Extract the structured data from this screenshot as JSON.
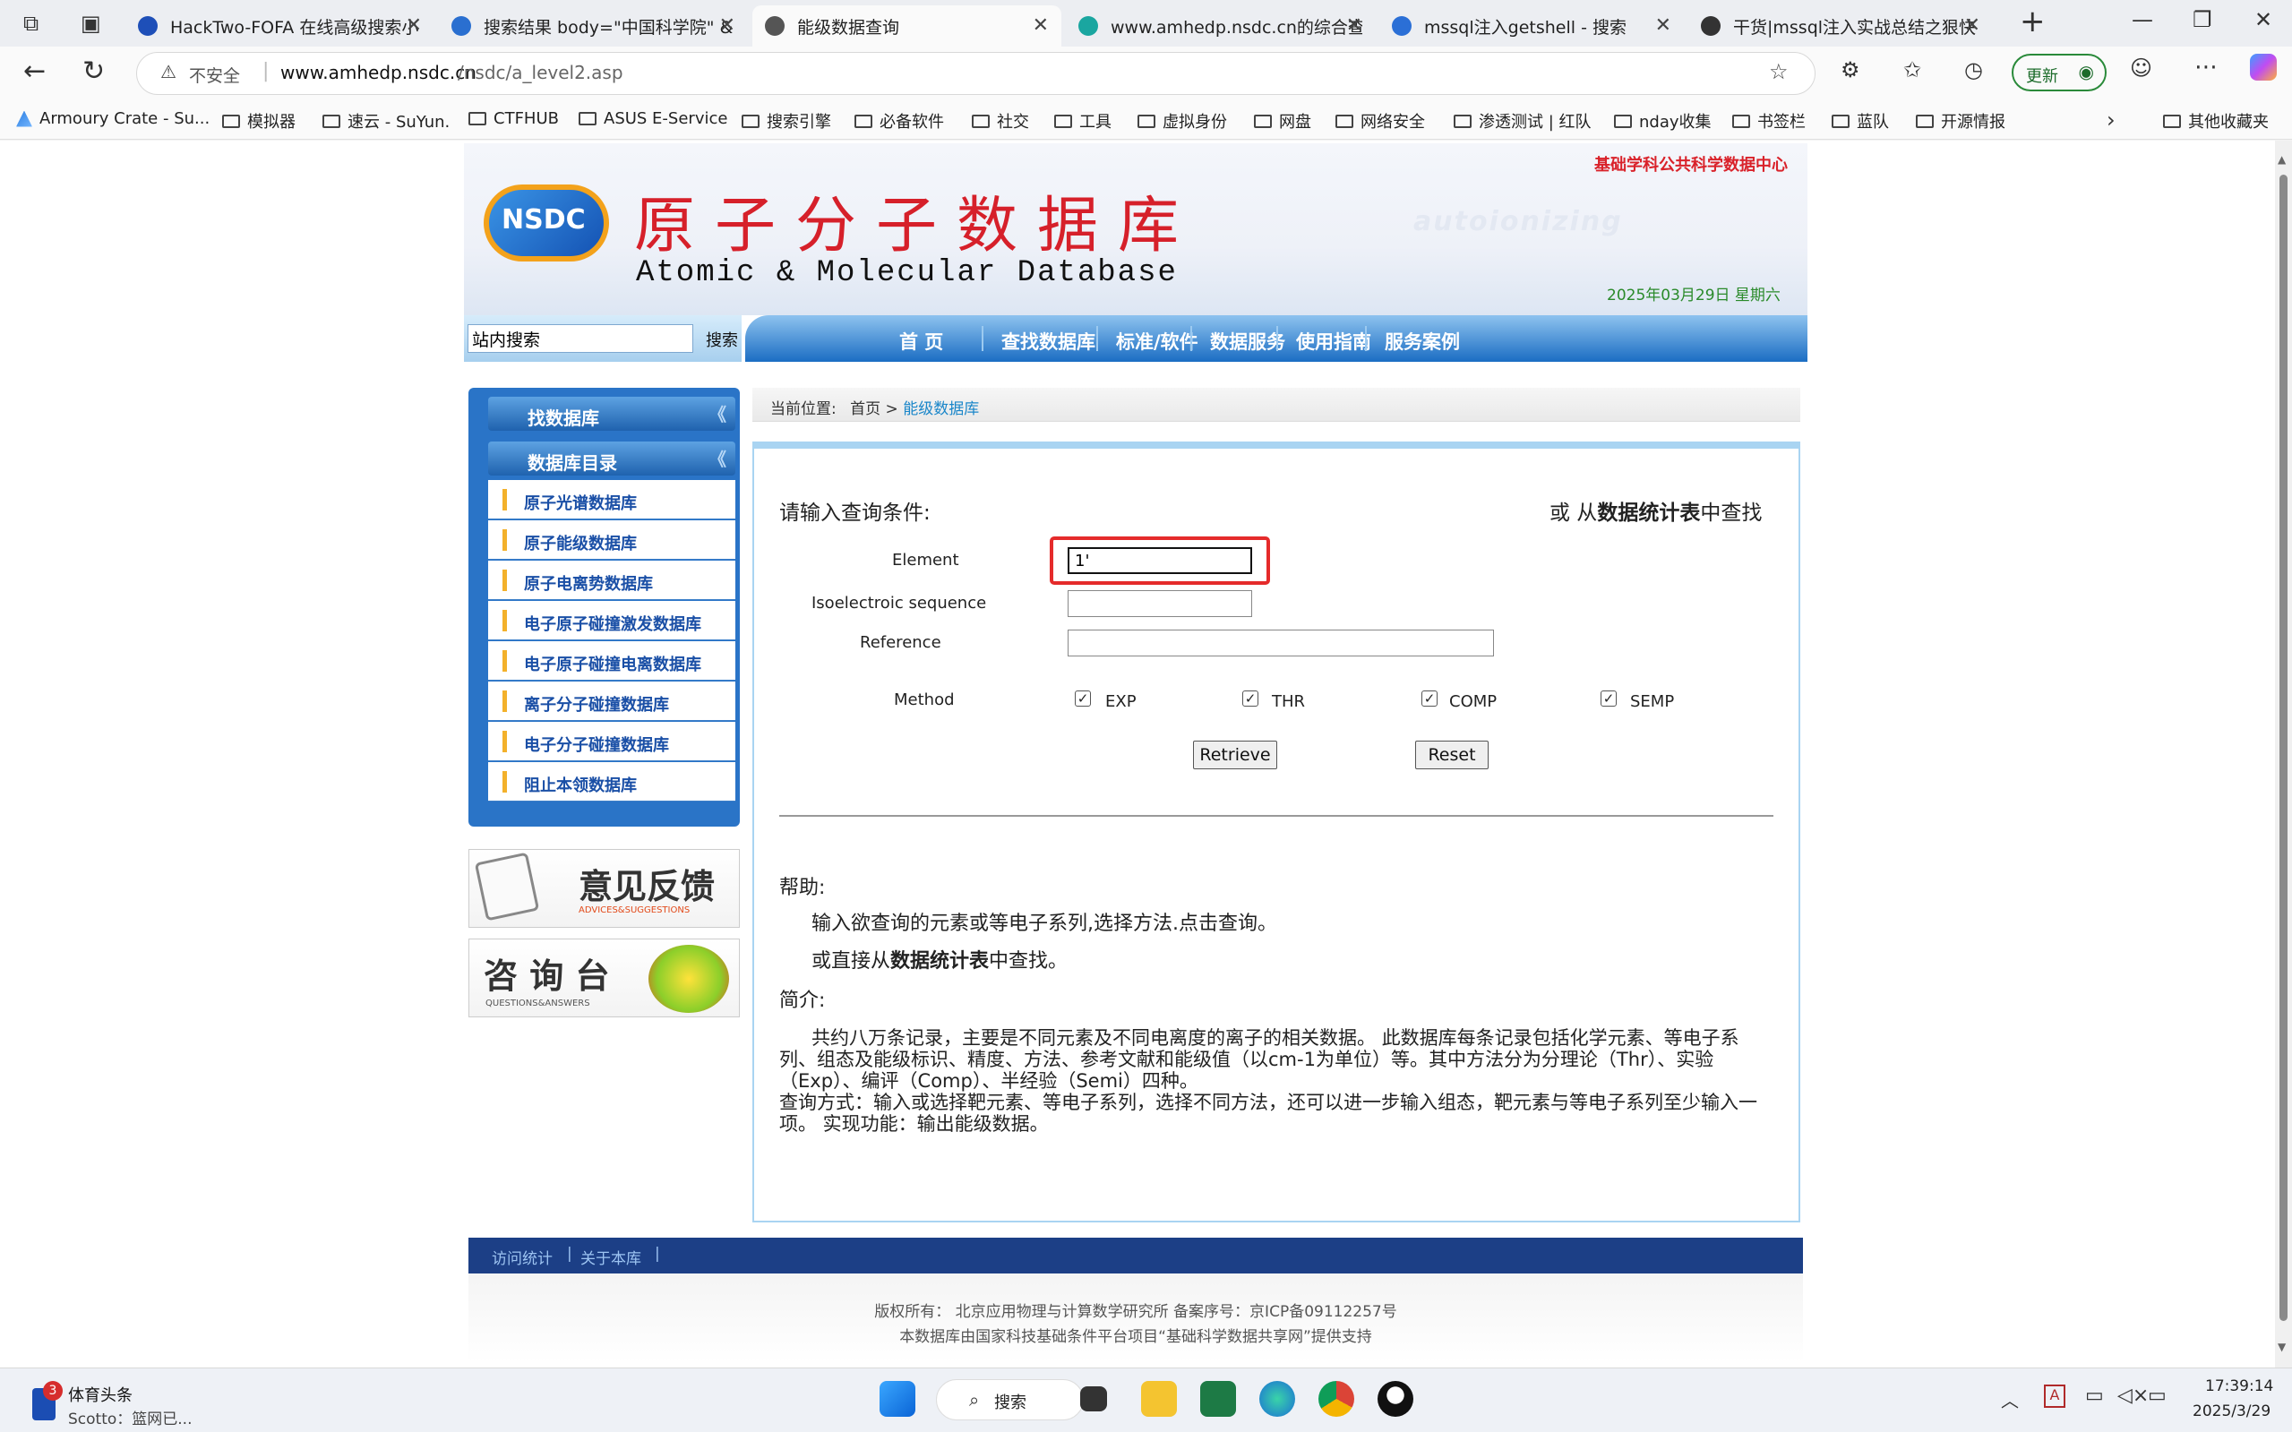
{
  "browser": {
    "tabs": [
      {
        "title": "HackTwo-FOFA 在线高级搜索小",
        "icon": "shield-icon",
        "color": "#1e4fb8"
      },
      {
        "title": "搜索结果 body=\"中国科学院\" &",
        "icon": "fofa-icon",
        "color": "#2a6fd0"
      },
      {
        "title": "能级数据查询",
        "icon": "globe-icon",
        "color": "#555555",
        "active": true
      },
      {
        "title": "www.amhedp.nsdc.cn的综合查询",
        "icon": "site-icon",
        "color": "#1aa6a0"
      },
      {
        "title": "mssql注入getshell - 搜索",
        "icon": "search-icon",
        "color": "#2b6fd6"
      },
      {
        "title": "干货|mssql注入实战总结之狠快",
        "icon": "doc-icon",
        "color": "#333333"
      }
    ],
    "address": {
      "security": "不安全",
      "url_host": "www.amhedp.nsdc.cn",
      "url_path": "/nsdc/a_level2.asp"
    },
    "update_label": "更新",
    "bookmarks": [
      "Armoury Crate - Su...",
      "模拟器",
      "速云 - SuYun.",
      "CTFHUB",
      "ASUS E-Service",
      "搜索引擎",
      "必备软件",
      "社交",
      "工具",
      "虚拟身份",
      "网盘",
      "网络安全",
      "渗透测试 | 红队",
      "nday收集",
      "书签栏",
      "蓝队",
      "开源情报"
    ],
    "other_bookmarks": "其他收藏夹"
  },
  "site": {
    "top_link": "基础学科公共科学数据中心",
    "logo_letters": "NSDC",
    "title_cn": "原子分子数据库",
    "title_en": "Atomic & Molecular Database",
    "date": "2025年03月29日 星期六",
    "search_placeholder": "站内搜索",
    "search_button": "搜索",
    "nav": [
      "首 页",
      "查找数据库",
      "标准/软件",
      "数据服务",
      "使用指南",
      "服务案例"
    ],
    "sidebar": {
      "header1": "找数据库",
      "header2": "数据库目录",
      "items": [
        "原子光谱数据库",
        "原子能级数据库",
        "原子电离势数据库",
        "电子原子碰撞激发数据库",
        "电子原子碰撞电离数据库",
        "离子分子碰撞数据库",
        "电子分子碰撞数据库",
        "阻止本领数据库"
      ]
    },
    "ad1": {
      "title": "意见反馈",
      "sub": "ADVICES&SUGGESTIONS"
    },
    "ad2": {
      "title": "咨 询 台",
      "sub": "QUESTIONS&ANSWERS"
    },
    "breadcrumb": {
      "prefix": "当前位置:",
      "home": "首页",
      "sep": ">",
      "current": "能级数据库"
    },
    "form": {
      "prompt": "请输入查询条件:",
      "alt_prefix": "或 从",
      "alt_link": "数据统计表",
      "alt_suffix": "中查找",
      "element_label": "Element",
      "element_value": "1'",
      "iso_label": "Isoelectroic sequence",
      "iso_value": "",
      "ref_label": "Reference",
      "ref_value": "",
      "method_label": "Method",
      "methods": [
        {
          "label": "EXP",
          "checked": true
        },
        {
          "label": "THR",
          "checked": true
        },
        {
          "label": "COMP",
          "checked": true
        },
        {
          "label": "SEMP",
          "checked": true
        }
      ],
      "retrieve": "Retrieve",
      "reset": "Reset"
    },
    "help": {
      "title": "帮助:",
      "line1": "输入欲查询的元素或等电子系列,选择方法.点击查询。",
      "line2_prefix": "或直接从",
      "line2_link": "数据统计表",
      "line2_suffix": "中查找。",
      "intro_title": "简介:",
      "intro1": "共约八万条记录，主要是不同元素及不同电离度的离子的相关数据。 此数据库每条记录包括化学元素、等电子系列、组态及能级标识、精度、方法、参考文献和能级值（以cm-1为单位）等。其中方法分为分理论（Thr）、实验（Exp）、编评（Comp）、半经验（Semi）四种。",
      "intro2": "查询方式：输入或选择靶元素、等电子系列，选择不同方法，还可以进一步输入组态，靶元素与等电子系列至少输入一项。 实现功能：输出能级数据。"
    },
    "footer_links": [
      "访问统计",
      "关于本库"
    ],
    "copyright": "版权所有：  北京应用物理与计算数学研究所 备案序号：京ICP备09112257号",
    "support": "本数据库由国家科技基础条件平台项目“基础科学数据共享网”提供支持"
  },
  "taskbar": {
    "news_badge": "3",
    "news_title": "体育头条",
    "news_sub": "Scotto：篮网已...",
    "search": "搜索",
    "time": "17:39:14",
    "date": "2025/3/29"
  }
}
